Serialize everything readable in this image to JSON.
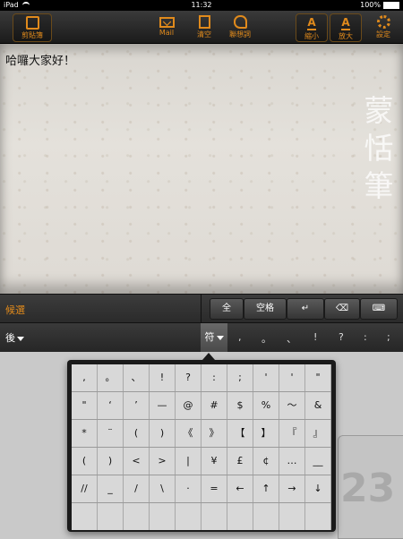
{
  "status": {
    "device": "iPad",
    "time": "11:32",
    "battery": "100%"
  },
  "toolbar": {
    "clipboard": "剪貼簿",
    "mail": "Mail",
    "clear": "清空",
    "associate": "聯想詞",
    "shrink": "縮小",
    "enlarge": "放大",
    "settings": "設定"
  },
  "editor": {
    "text": "哈囉大家好！"
  },
  "logo": {
    "c1": "蒙",
    "c2": "恬",
    "c3": "筆"
  },
  "candidate_bar": {
    "label": "候選",
    "full": "全",
    "space": "空格"
  },
  "second_bar": {
    "back": "後",
    "fu": "符",
    "punct": [
      ",",
      "。",
      "、",
      "!",
      "?",
      ":",
      ";"
    ]
  },
  "symbols": [
    ",",
    "。",
    "、",
    "!",
    "?",
    ":",
    ";",
    "'",
    "'",
    "\"",
    "\"",
    "‘",
    "’",
    "—",
    "@",
    "#",
    "$",
    "%",
    "～",
    "&",
    "*",
    "¨",
    "(",
    ")",
    "《",
    "》",
    "【",
    "】",
    "『",
    "』",
    "(",
    ")",
    "<",
    ">",
    "|",
    "¥",
    "£",
    "¢",
    "…",
    "__",
    "//",
    "_",
    "/",
    "\\",
    "·",
    "=",
    "←",
    "↑",
    "→",
    "↓",
    "",
    "",
    "",
    "",
    "",
    "",
    "",
    "",
    "",
    ""
  ],
  "ghost_key": {
    "label": "23"
  }
}
